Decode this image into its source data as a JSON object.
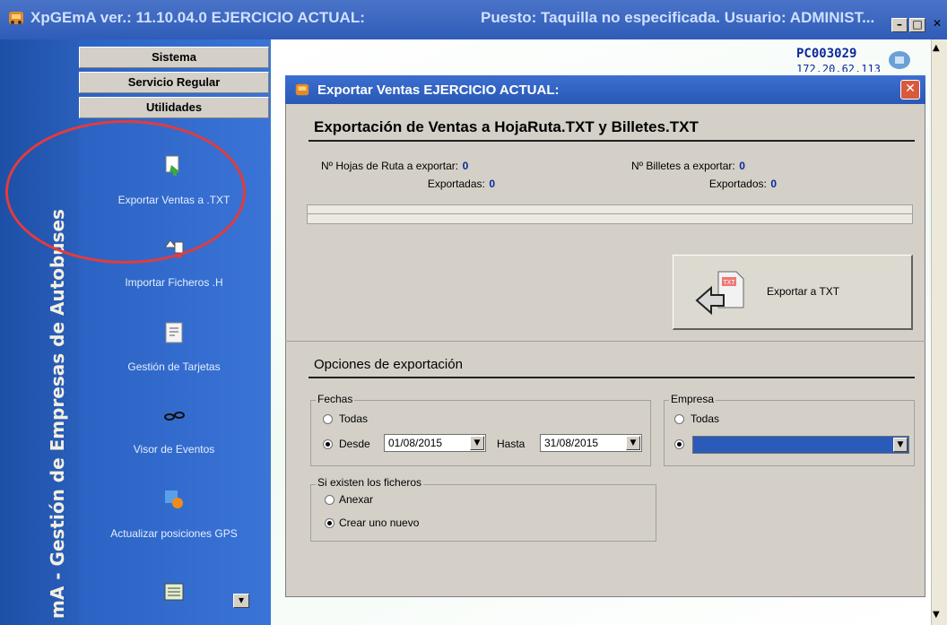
{
  "window": {
    "title": "XpGEmA ver.: 11.10.04.0  EJERCICIO ACTUAL:",
    "session": "Puesto: Taquilla no especificada. Usuario: ADMINIST...",
    "buttons": {
      "minimize": "–",
      "maximize": "□",
      "close": "✕"
    }
  },
  "left_band_title": "mA - Gestión de Empresas de Autobuses",
  "sidebar": {
    "menu": [
      "Sistema",
      "Servicio Regular",
      "Utilidades"
    ],
    "items": [
      {
        "label": "Exportar Ventas a .TXT",
        "icon": "export-icon"
      },
      {
        "label": "Importar Ficheros .H",
        "icon": "import-icon"
      },
      {
        "label": "Gestión de Tarjetas",
        "icon": "cards-icon"
      },
      {
        "label": "Visor de Eventos",
        "icon": "glasses-icon"
      },
      {
        "label": "Actualizar posiciones GPS",
        "icon": "gps-icon"
      },
      {
        "label": "",
        "icon": "list-icon"
      }
    ]
  },
  "pc": {
    "name": "PC003029",
    "ip": "172.20.62.113"
  },
  "dialog": {
    "title": "Exportar Ventas     EJERCICIO ACTUAL:",
    "heading": "Exportación de Ventas a HojaRuta.TXT y Billetes.TXT",
    "hojas_label": "Nº Hojas de Ruta a exportar:",
    "hojas_value": "0",
    "hojas_exported_label": "Exportadas:",
    "hojas_exported_value": "0",
    "billetes_label": "Nº Billetes a exportar:",
    "billetes_value": "0",
    "billetes_exported_label": "Exportados:",
    "billetes_exported_value": "0",
    "export_button": "Exportar a TXT",
    "export_icon_text": "TXT",
    "options_heading": "Opciones de exportación",
    "fechas": {
      "group": "Fechas",
      "todas": "Todas",
      "desde": "Desde",
      "desde_value": "01/08/2015",
      "hasta": "Hasta",
      "hasta_value": "31/08/2015"
    },
    "empresa": {
      "group": "Empresa",
      "todas": "Todas",
      "selected": ""
    },
    "ficheros": {
      "group": "Si existen los ficheros",
      "anexar": "Anexar",
      "crear": "Crear uno nuevo"
    }
  },
  "colors": {
    "title_bar": "#2f5cb8",
    "sidebar": "#2b63c4",
    "highlight": "#e23c3c",
    "value_blue": "#0b2a9a",
    "dialog_bg": "#d4d0c8"
  }
}
